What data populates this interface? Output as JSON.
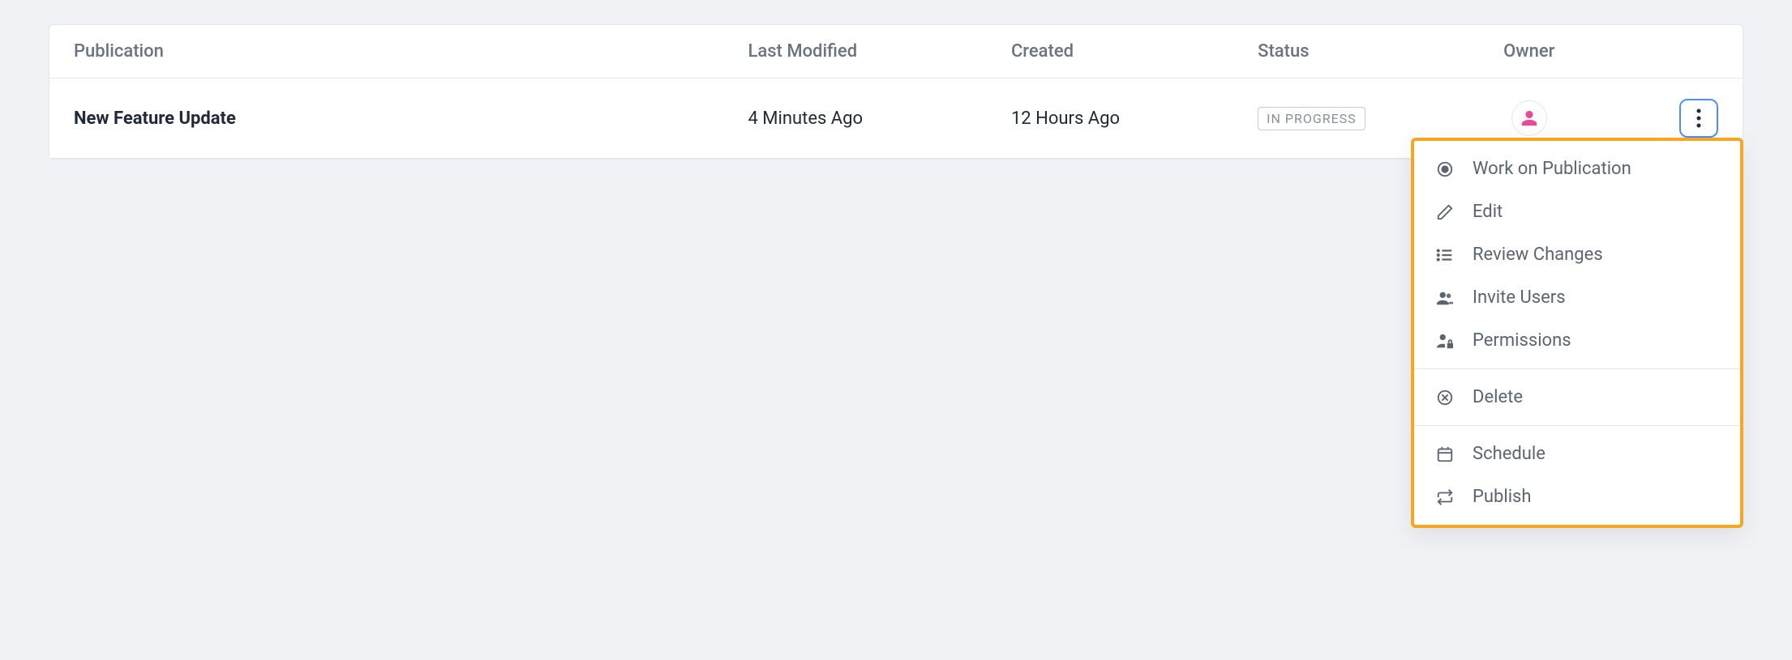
{
  "table": {
    "headers": {
      "publication": "Publication",
      "last_modified": "Last Modified",
      "created": "Created",
      "status": "Status",
      "owner": "Owner"
    },
    "row": {
      "title": "New Feature Update",
      "last_modified": "4 Minutes Ago",
      "created": "12 Hours Ago",
      "status": "IN PROGRESS"
    }
  },
  "dropdown": {
    "work": "Work on Publication",
    "edit": "Edit",
    "review": "Review Changes",
    "invite": "Invite Users",
    "permissions": "Permissions",
    "delete": "Delete",
    "schedule": "Schedule",
    "publish": "Publish"
  }
}
